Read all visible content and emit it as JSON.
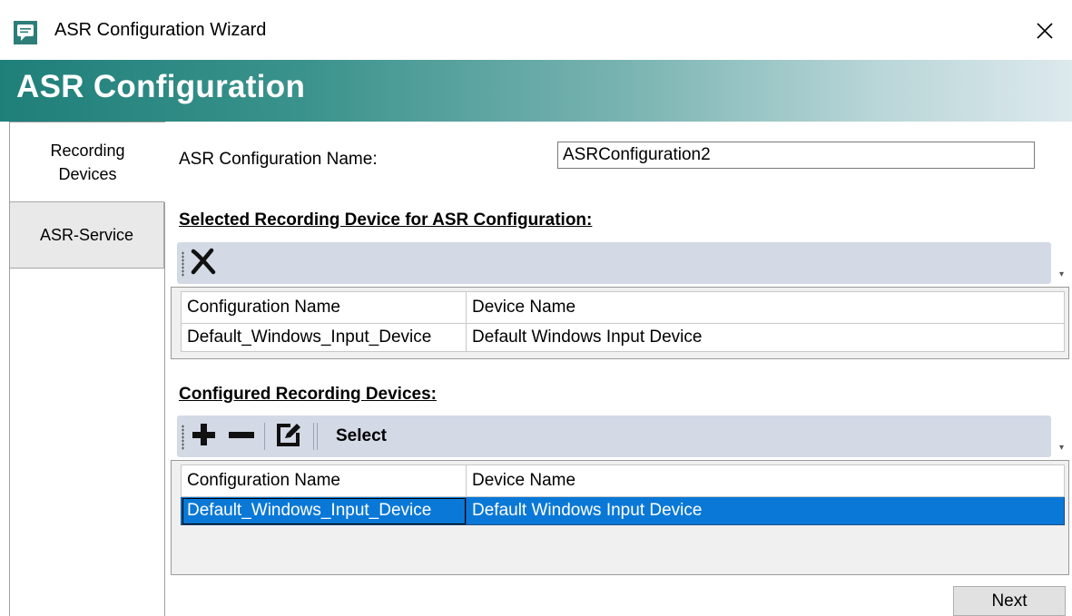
{
  "window": {
    "title": "ASR Configuration Wizard"
  },
  "banner": {
    "title": "ASR Configuration"
  },
  "sidebar": {
    "tabs": [
      {
        "label_line1": "Recording",
        "label_line2": "Devices",
        "selected": true
      },
      {
        "label": "ASR-Service",
        "selected": false
      }
    ]
  },
  "form": {
    "name_label": "ASR Configuration Name:",
    "name_value": "ASRConfiguration2"
  },
  "selected_section": {
    "heading": "Selected Recording Device for ASR Configuration:",
    "columns": [
      "Configuration Name",
      "Device Name"
    ],
    "rows": [
      {
        "config": "Default_Windows_Input_Device",
        "device": "Default Windows Input Device"
      }
    ]
  },
  "configured_section": {
    "heading": "Configured Recording Devices:",
    "toolbar": {
      "select_label": "Select"
    },
    "columns": [
      "Configuration Name",
      "Device Name"
    ],
    "rows": [
      {
        "config": "Default_Windows_Input_Device",
        "device": "Default Windows Input Device",
        "selected": true
      }
    ]
  },
  "footer": {
    "next_label": "Next"
  },
  "colors": {
    "banner_start": "#1f7f79",
    "banner_end": "#dde9ed",
    "selection": "#0a78d7",
    "toolbar_bg": "#d4d9e6"
  },
  "icons": [
    "app-chat-icon",
    "close-icon",
    "remove-x-icon",
    "add-plus-icon",
    "remove-minus-icon",
    "edit-icon",
    "toolbar-grip-icon",
    "overflow-chevron-icon"
  ]
}
